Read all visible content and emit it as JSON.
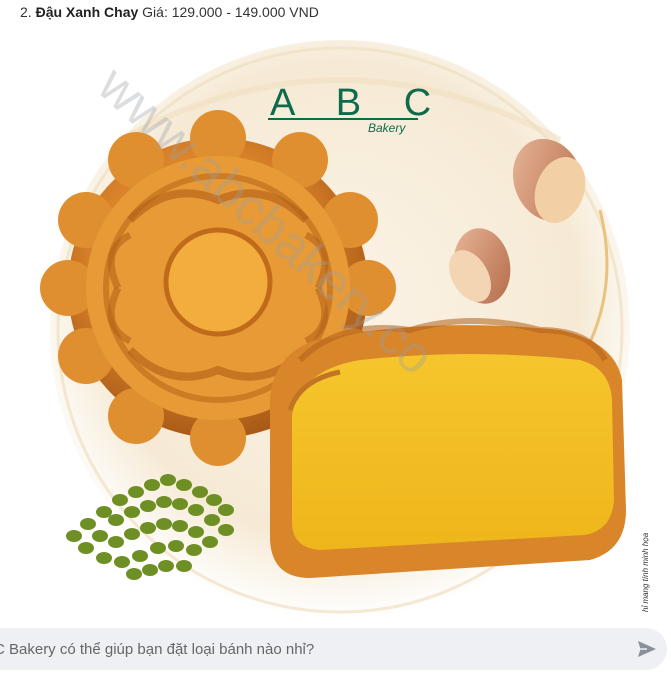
{
  "product": {
    "index": "2.",
    "name": "Đậu Xanh Chay",
    "price_label": "Giá: 129.000 - 149.000 VND"
  },
  "promo": {
    "logo_letters": "A B C",
    "logo_sub": "Bakery",
    "watermark": "www.abcbakery.co",
    "caption": "hỉ mang tính minh họa"
  },
  "chat": {
    "placeholder": "C Bakery có thể giúp bạn đặt loại bánh nào nhỉ?",
    "send_icon": "send-icon"
  },
  "colors": {
    "brand_green": "#0d6b4b",
    "crust": "#d9852a",
    "filling": "#f4c024",
    "bean": "#6e8f24",
    "chat_bg": "#eef0f4"
  }
}
